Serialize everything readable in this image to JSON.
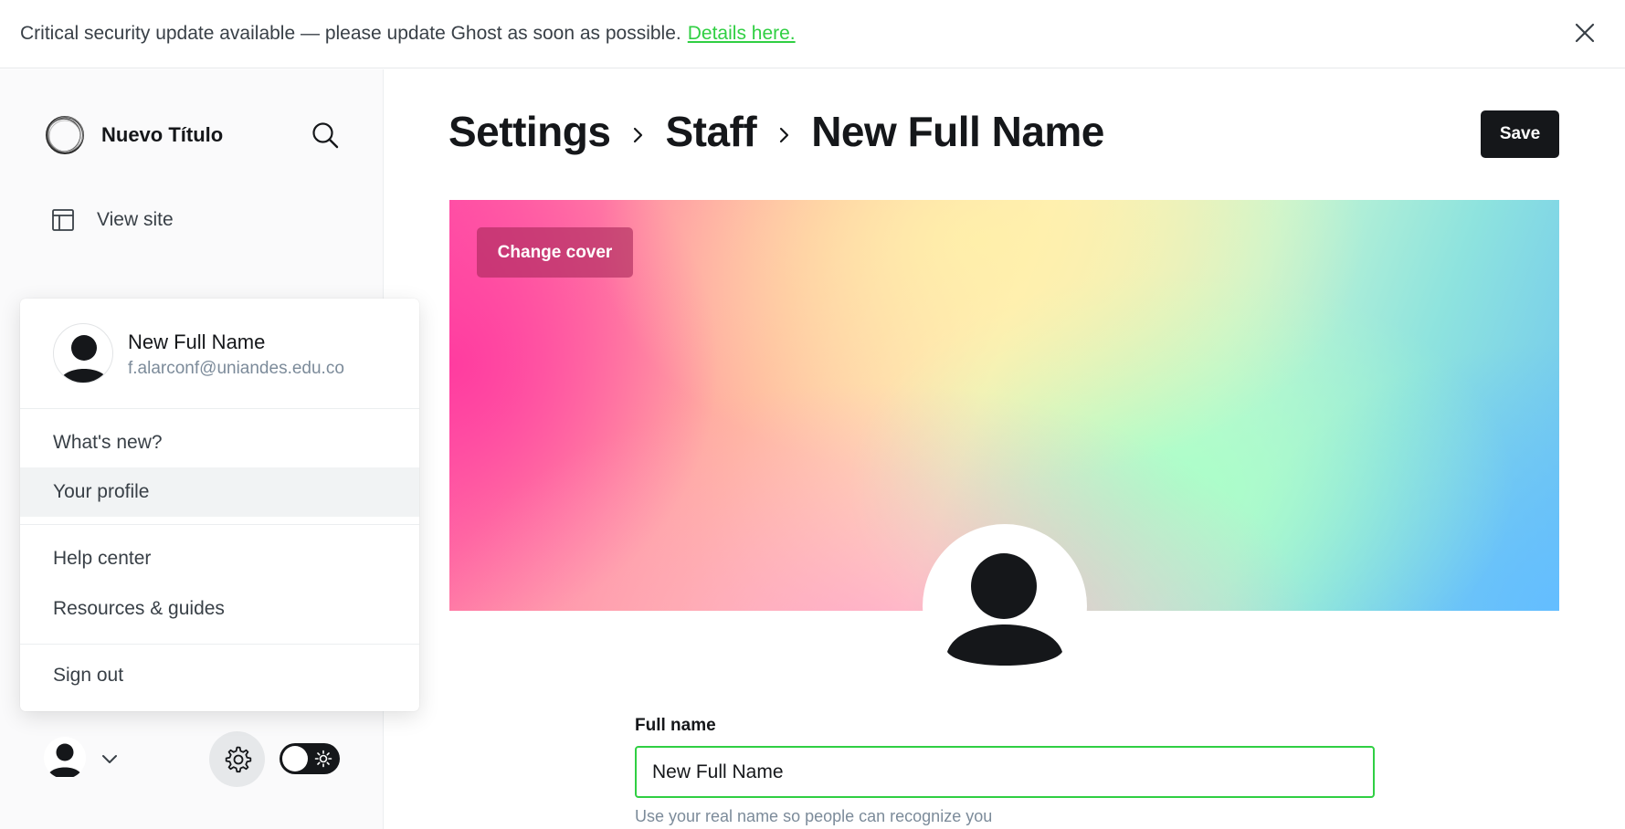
{
  "banner": {
    "message": "Critical security update available — please update Ghost as soon as possible.",
    "link": "Details here."
  },
  "sidebar": {
    "site_title": "Nuevo Título",
    "view_site": "View site"
  },
  "user_menu": {
    "name": "New Full Name",
    "email": "f.alarconf@uniandes.edu.co",
    "items": [
      {
        "label": "What's new?"
      },
      {
        "label": "Your profile",
        "highlighted": true
      },
      {
        "label": "Help center"
      },
      {
        "label": "Resources & guides"
      },
      {
        "label": "Sign out"
      }
    ]
  },
  "header": {
    "breadcrumb": [
      "Settings",
      "Staff",
      "New Full Name"
    ],
    "save": "Save"
  },
  "cover": {
    "change_cover": "Change cover"
  },
  "form": {
    "full_name_label": "Full name",
    "full_name_value": "New Full Name",
    "full_name_hint": "Use your real name so people can recognize you"
  },
  "colors": {
    "accent_green": "#30cf43",
    "dark": "#15171a"
  },
  "icons": {
    "close": "close-icon",
    "search": "search-icon",
    "view_site": "layout-icon",
    "settings": "gear-icon",
    "chevron": "chevron-down-icon",
    "theme": "sun-icon"
  }
}
